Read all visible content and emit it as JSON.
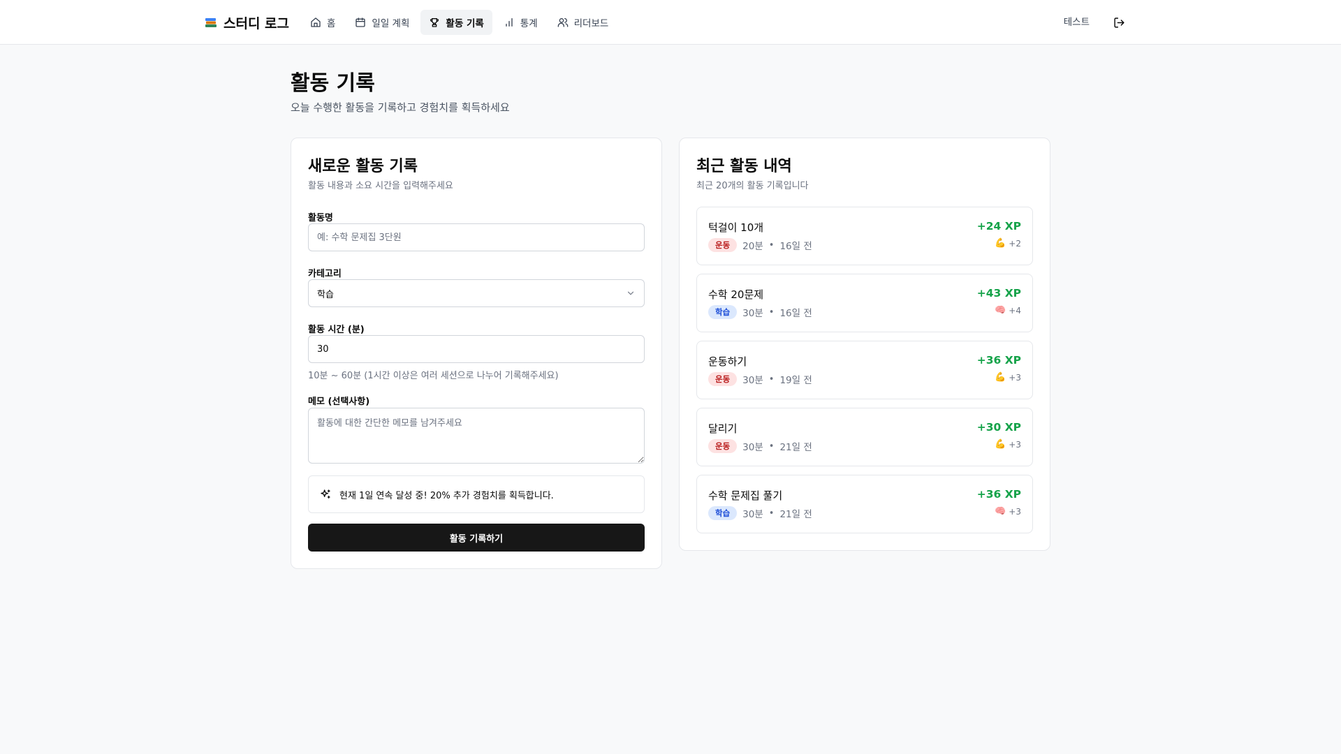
{
  "header": {
    "brand": "스터디 로그",
    "nav": [
      {
        "label": "홈",
        "icon": "home-icon"
      },
      {
        "label": "일일 계획",
        "icon": "calendar-icon"
      },
      {
        "label": "활동 기록",
        "icon": "trophy-icon",
        "active": true
      },
      {
        "label": "통계",
        "icon": "bar-chart-icon"
      },
      {
        "label": "리더보드",
        "icon": "users-icon"
      }
    ],
    "user": "테스트"
  },
  "page": {
    "title": "활동 기록",
    "subtitle": "오늘 수행한 활동을 기록하고 경험치를 획득하세요"
  },
  "form": {
    "title": "새로운 활동 기록",
    "description": "활동 내용과 소요 시간을 입력해주세요",
    "name_label": "활동명",
    "name_placeholder": "예: 수학 문제집 3단원",
    "category_label": "카테고리",
    "category_value": "학습",
    "duration_label": "활동 시간 (분)",
    "duration_value": "30",
    "duration_helper": "10분 ~ 60분 (1시간 이상은 여러 세션으로 나누어 기록해주세요)",
    "memo_label": "메모 (선택사항)",
    "memo_placeholder": "활동에 대한 간단한 메모를 남겨주세요",
    "notice": "현재 1일 연속 달성 중! 20% 추가 경험치를 획득합니다.",
    "submit": "활동 기록하기"
  },
  "recent": {
    "title": "최근 활동 내역",
    "description": "최근 20개의 활동 기록입니다",
    "items": [
      {
        "name": "턱걸이 10개",
        "category": "운동",
        "type": "exercise",
        "duration": "20분",
        "ago": "16일 전",
        "xp": "+24 XP",
        "stat_icon": "💪",
        "stat": "+2"
      },
      {
        "name": "수학 20문제",
        "category": "학습",
        "type": "study",
        "duration": "30분",
        "ago": "16일 전",
        "xp": "+43 XP",
        "stat_icon": "🧠",
        "stat": "+4"
      },
      {
        "name": "운동하기",
        "category": "운동",
        "type": "exercise",
        "duration": "30분",
        "ago": "19일 전",
        "xp": "+36 XP",
        "stat_icon": "💪",
        "stat": "+3"
      },
      {
        "name": "달리기",
        "category": "운동",
        "type": "exercise",
        "duration": "30분",
        "ago": "21일 전",
        "xp": "+30 XP",
        "stat_icon": "💪",
        "stat": "+3"
      },
      {
        "name": "수학 문제집 풀기",
        "category": "학습",
        "type": "study",
        "duration": "30분",
        "ago": "21일 전",
        "xp": "+36 XP",
        "stat_icon": "🧠",
        "stat": "+3"
      }
    ]
  }
}
